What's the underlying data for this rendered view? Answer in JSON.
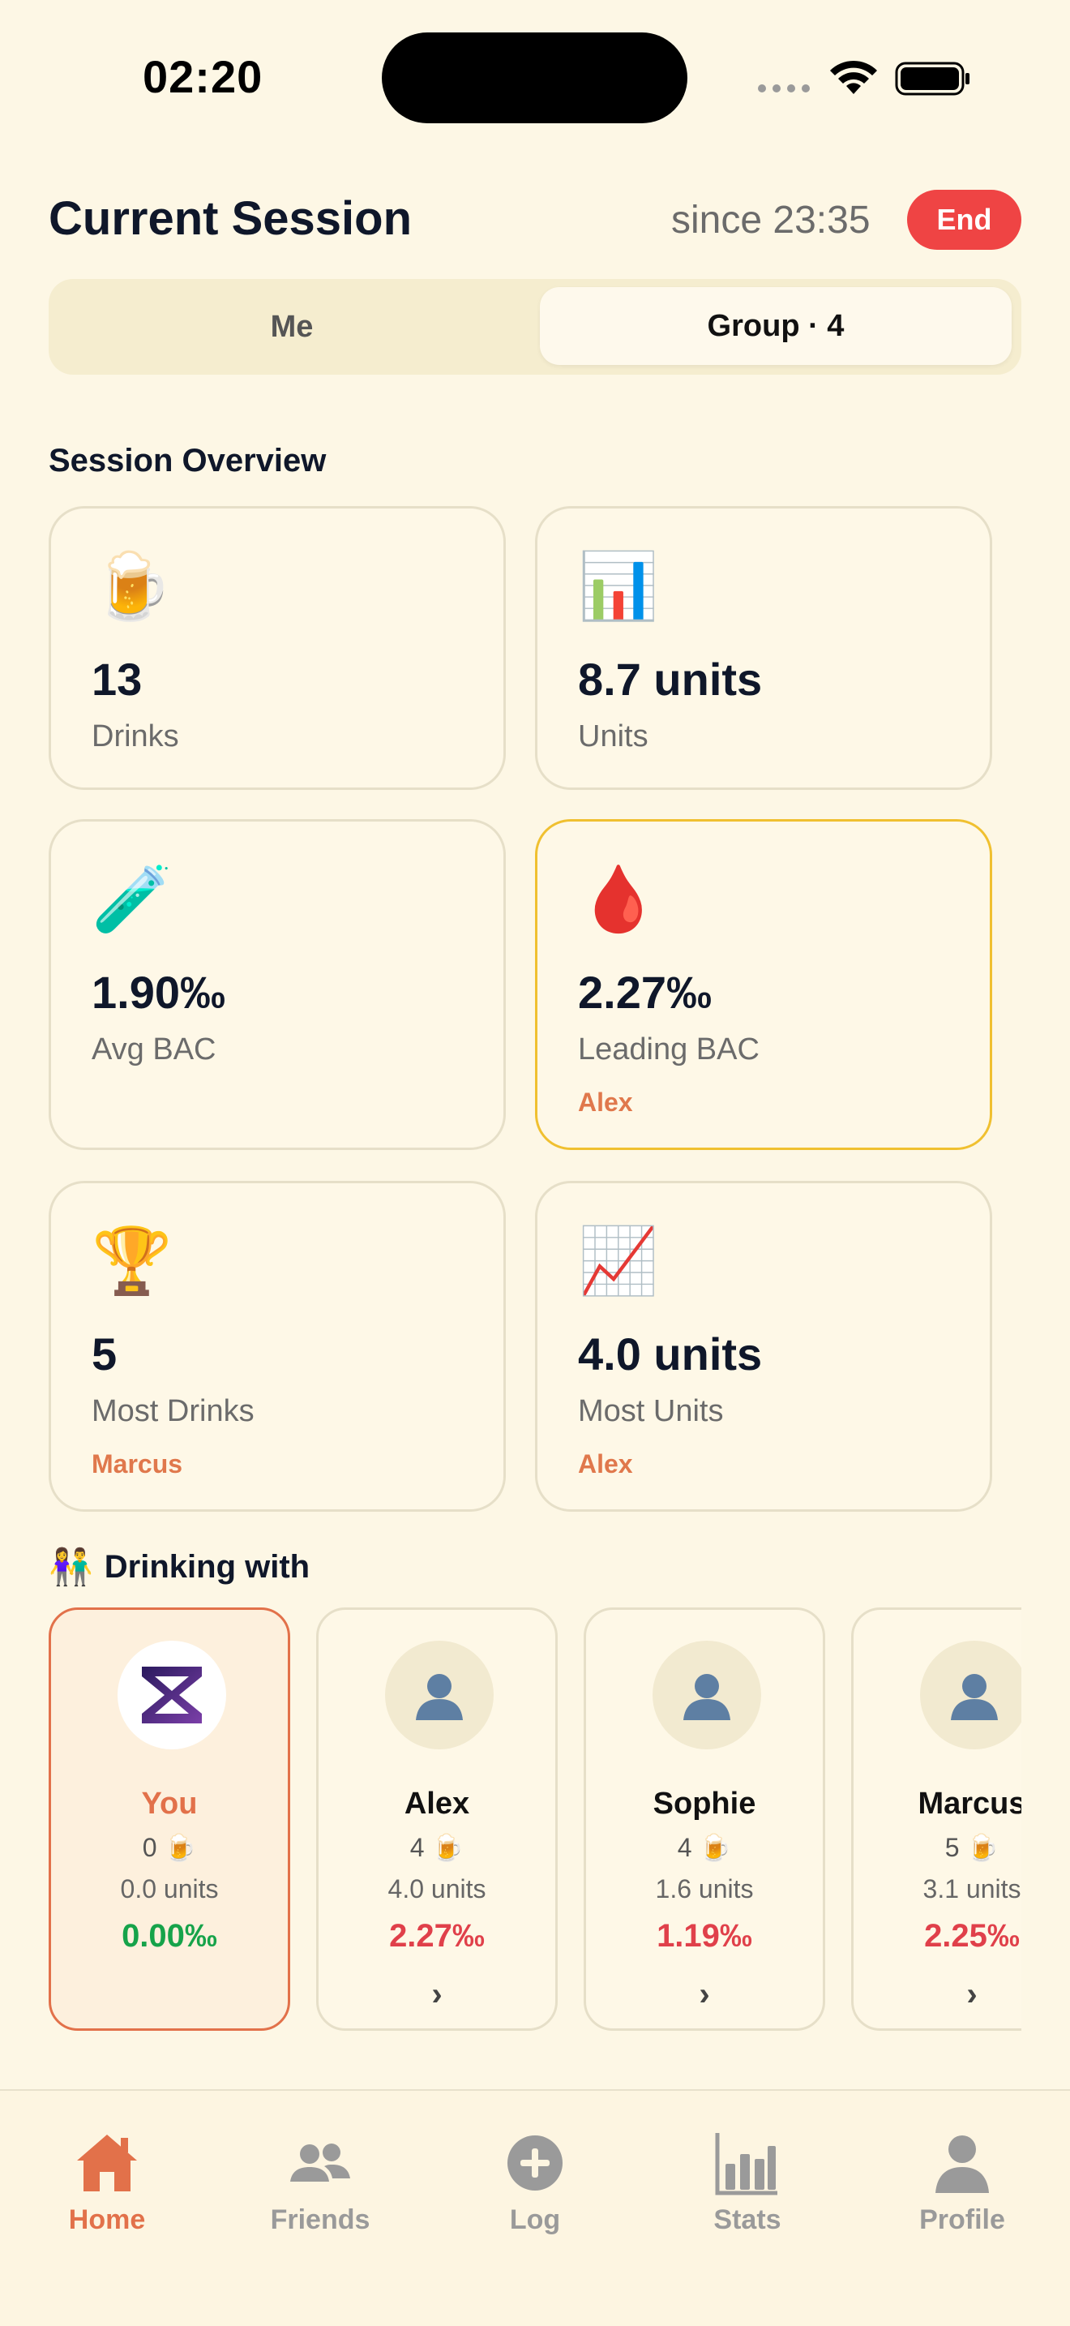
{
  "status": {
    "time": "02:20"
  },
  "header": {
    "title": "Current Session",
    "since": "since 23:35",
    "end_label": "End"
  },
  "segment": {
    "me": "Me",
    "group": "Group · 4",
    "active": "group"
  },
  "overview": {
    "title": "Session Overview",
    "cards": [
      {
        "icon": "beer-mug-icon",
        "emoji": "🍺",
        "value": "13",
        "label": "Drinks",
        "sub": ""
      },
      {
        "icon": "bar-chart-icon",
        "emoji": "📊",
        "value": "8.7 units",
        "label": "Units",
        "sub": ""
      },
      {
        "icon": "test-tube-icon",
        "emoji": "🧪",
        "value": "1.90‰",
        "label": "Avg BAC",
        "sub": ""
      },
      {
        "icon": "blood-drop-icon",
        "emoji": "🩸",
        "value": "2.27‰",
        "label": "Leading BAC",
        "sub": "Alex"
      },
      {
        "icon": "trophy-icon",
        "emoji": "🏆",
        "value": "5",
        "label": "Most Drinks",
        "sub": "Marcus"
      },
      {
        "icon": "chart-increasing-icon",
        "emoji": "📈",
        "value": "4.0 units",
        "label": "Most Units",
        "sub": "Alex"
      }
    ]
  },
  "drinking_with": {
    "title": "Drinking with",
    "icon": "people-icon",
    "people": [
      {
        "name": "You",
        "drinks": "0",
        "units": "0.0 units",
        "bac": "0.00‰",
        "self": true
      },
      {
        "name": "Alex",
        "drinks": "4",
        "units": "4.0 units",
        "bac": "2.27‰",
        "chevron": "›"
      },
      {
        "name": "Sophie",
        "drinks": "4",
        "units": "1.6 units",
        "bac": "1.19‰",
        "chevron": "›"
      },
      {
        "name": "Marcus",
        "drinks": "5",
        "units": "3.1 units",
        "bac": "2.25‰",
        "chevron": "›"
      }
    ],
    "mug": "🍺"
  },
  "tabs": [
    {
      "label": "Home",
      "icon": "home-icon",
      "active": true
    },
    {
      "label": "Friends",
      "icon": "friends-icon",
      "active": false
    },
    {
      "label": "Log",
      "icon": "plus-circle-icon",
      "active": false
    },
    {
      "label": "Stats",
      "icon": "bar-chart-icon",
      "active": false
    },
    {
      "label": "Profile",
      "icon": "person-icon",
      "active": false
    }
  ],
  "colors": {
    "background": "#FDF7E5",
    "accent": "#E2714A",
    "danger": "#EF4444",
    "success": "#16A34A",
    "highlight_border": "#F0C030"
  }
}
